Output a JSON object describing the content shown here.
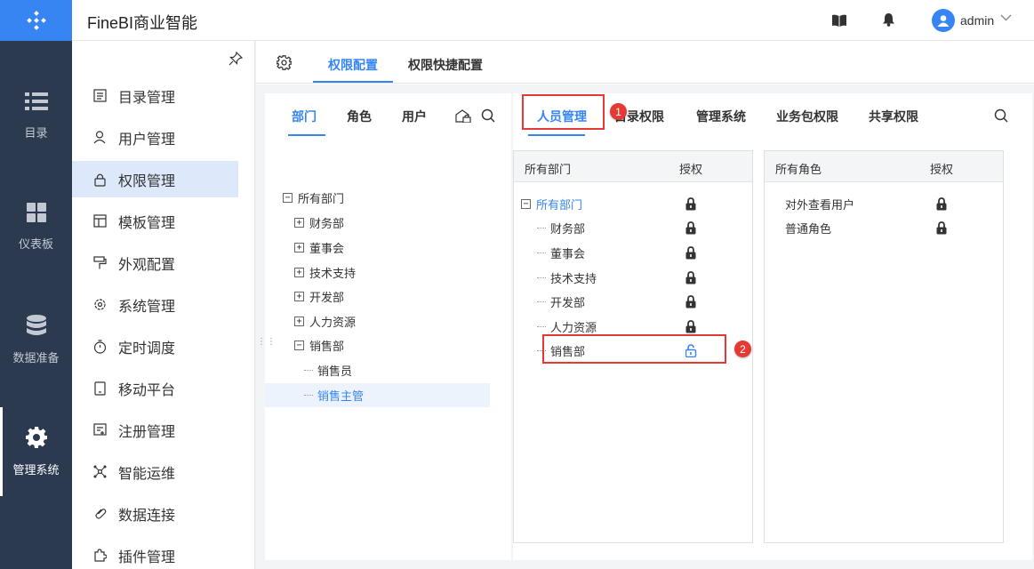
{
  "app": {
    "title": "FineBI商业智能"
  },
  "user": {
    "name": "admin"
  },
  "nav": {
    "items": [
      {
        "label": "目录",
        "icon": "list-icon"
      },
      {
        "label": "仪表板",
        "icon": "dashboard-icon"
      },
      {
        "label": "数据准备",
        "icon": "database-icon"
      },
      {
        "label": "管理系统",
        "icon": "gear-icon",
        "active": true
      }
    ]
  },
  "menu": {
    "items": [
      {
        "label": "目录管理"
      },
      {
        "label": "用户管理"
      },
      {
        "label": "权限管理",
        "active": true
      },
      {
        "label": "模板管理"
      },
      {
        "label": "外观配置"
      },
      {
        "label": "系统管理"
      },
      {
        "label": "定时调度"
      },
      {
        "label": "移动平台"
      },
      {
        "label": "注册管理"
      },
      {
        "label": "智能运维"
      },
      {
        "label": "数据连接"
      },
      {
        "label": "插件管理"
      }
    ]
  },
  "tabs": {
    "items": [
      {
        "label": "权限配置",
        "active": true
      },
      {
        "label": "权限快捷配置"
      }
    ]
  },
  "left_panel": {
    "subtabs": [
      {
        "label": "部门",
        "active": true
      },
      {
        "label": "角色"
      },
      {
        "label": "用户"
      }
    ],
    "tree": [
      {
        "label": "所有部门",
        "toggle": "−",
        "level": 0
      },
      {
        "label": "财务部",
        "toggle": "+",
        "level": 1
      },
      {
        "label": "董事会",
        "toggle": "+",
        "level": 1
      },
      {
        "label": "技术支持",
        "toggle": "+",
        "level": 1
      },
      {
        "label": "开发部",
        "toggle": "+",
        "level": 1
      },
      {
        "label": "人力资源",
        "toggle": "+",
        "level": 1
      },
      {
        "label": "销售部",
        "toggle": "−",
        "level": 1
      },
      {
        "label": "销售员",
        "level": 2
      },
      {
        "label": "销售主管",
        "level": 2,
        "selected": true
      }
    ]
  },
  "right_panel": {
    "tabs": [
      {
        "label": "人员管理",
        "active": true
      },
      {
        "label": "目录权限"
      },
      {
        "label": "管理系统"
      },
      {
        "label": "业务包权限"
      },
      {
        "label": "共享权限"
      }
    ],
    "dept_grid": {
      "header_name": "所有部门",
      "header_auth": "授权",
      "rows": [
        {
          "label": "所有部门",
          "toggle": "−",
          "locked": true,
          "highlight": true
        },
        {
          "label": "财务部",
          "locked": true
        },
        {
          "label": "董事会",
          "locked": true
        },
        {
          "label": "技术支持",
          "locked": true
        },
        {
          "label": "开发部",
          "locked": true
        },
        {
          "label": "人力资源",
          "locked": true
        },
        {
          "label": "销售部",
          "locked": false
        }
      ]
    },
    "role_grid": {
      "header_name": "所有角色",
      "header_auth": "授权",
      "rows": [
        {
          "label": "对外查看用户",
          "locked": true
        },
        {
          "label": "普通角色",
          "locked": true
        }
      ]
    }
  },
  "annotations": {
    "badge1": "1",
    "badge2": "2"
  },
  "colors": {
    "accent": "#3685f2",
    "nav_bg": "#2c3a4f",
    "annotation": "#e53935"
  }
}
